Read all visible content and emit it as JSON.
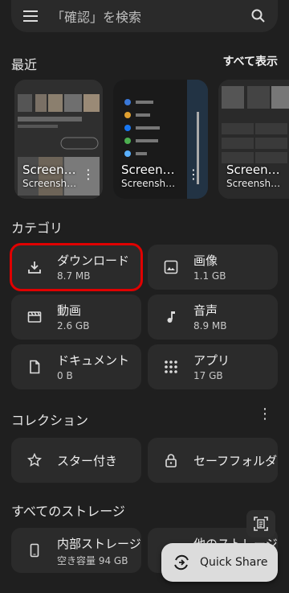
{
  "search": {
    "placeholder": "「確認」を検索"
  },
  "recent": {
    "title": "最近",
    "see_all": "すべて表示",
    "cards": [
      {
        "title": "Screen…",
        "sub": "Screensh…"
      },
      {
        "title": "Screen…",
        "sub": "Screensh…"
      },
      {
        "title": "Screen…",
        "sub": "Screensh…"
      }
    ]
  },
  "categories": {
    "title": "カテゴリ",
    "items": [
      {
        "name": "ダウンロード",
        "size": "8.7 MB"
      },
      {
        "name": "画像",
        "size": "1.1 GB"
      },
      {
        "name": "動画",
        "size": "2.6 GB"
      },
      {
        "name": "音声",
        "size": "8.9 MB"
      },
      {
        "name": "ドキュメント",
        "size": "0 B"
      },
      {
        "name": "アプリ",
        "size": "17 GB"
      }
    ]
  },
  "collections": {
    "title": "コレクション",
    "items": [
      {
        "name": "スター付き"
      },
      {
        "name": "セーフフォルダ"
      }
    ]
  },
  "storage": {
    "title": "すべてのストレージ",
    "items": [
      {
        "name": "内部ストレージ",
        "detail": "空き容量 94 GB"
      },
      {
        "name": "他のストレージ"
      }
    ]
  },
  "quick_share": {
    "label": "Quick Share"
  },
  "colors": {
    "background": "#1f1f1f",
    "card": "#2b2b2b",
    "highlight": "#e00000",
    "fab": "#dcdcdc"
  }
}
